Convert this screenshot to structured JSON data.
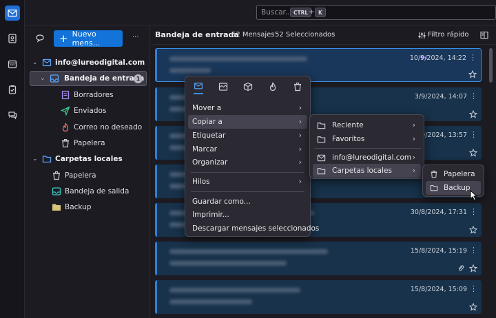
{
  "search": {
    "placeholder": "Buscar...",
    "key1": "CTRL",
    "plus": "+",
    "key2": "K"
  },
  "toolbar": {
    "new_message": "Nuevo mens...",
    "more": "···"
  },
  "folders": {
    "account": "info@lureodigital.com",
    "inbox": "Bandeja de entrada",
    "inbox_unread": "1",
    "drafts": "Borradores",
    "sent": "Enviados",
    "junk": "Correo no deseado",
    "trash": "Papelera",
    "local_folders": "Carpetas locales",
    "local_trash": "Papelera",
    "outbox": "Bandeja de salida",
    "backup": "Backup"
  },
  "list_header": {
    "title": "Bandeja de entrada",
    "message_count": "52 Mensajes",
    "selected_count": "52 Seleccionados",
    "quick_filter": "Filtro rápido"
  },
  "messages": [
    {
      "date": "10/9/2024, 14:22",
      "replied": true
    },
    {
      "date": "3/9/2024, 14:07"
    },
    {
      "date": "3/9/2024, 13:57"
    },
    {
      "date": ""
    },
    {
      "date": "30/8/2024, 17:31"
    },
    {
      "date": "15/8/2024, 15:19",
      "attachment": true
    },
    {
      "date": "15/8/2024, 15:09"
    }
  ],
  "context_menu": {
    "icons": [
      "mail-icon",
      "archive-icon",
      "package-icon",
      "fire-icon",
      "trash-icon"
    ],
    "move_to": "Mover a",
    "copy_to": "Copiar a",
    "tag": "Etiquetar",
    "mark": "Marcar",
    "organize": "Organizar",
    "threads": "Hilos",
    "save_as": "Guardar como...",
    "print": "Imprimir...",
    "download": "Descargar mensajes seleccionados"
  },
  "copy_submenu": {
    "recent": "Reciente",
    "favorites": "Favoritos",
    "account": "info@lureodigital.com",
    "local_folders": "Carpetas locales"
  },
  "local_submenu": {
    "trash": "Papelera",
    "backup": "Backup"
  },
  "colors": {
    "accent": "#1373d9",
    "card_bg": "#17324a",
    "menu_bg": "#2b2a33"
  }
}
